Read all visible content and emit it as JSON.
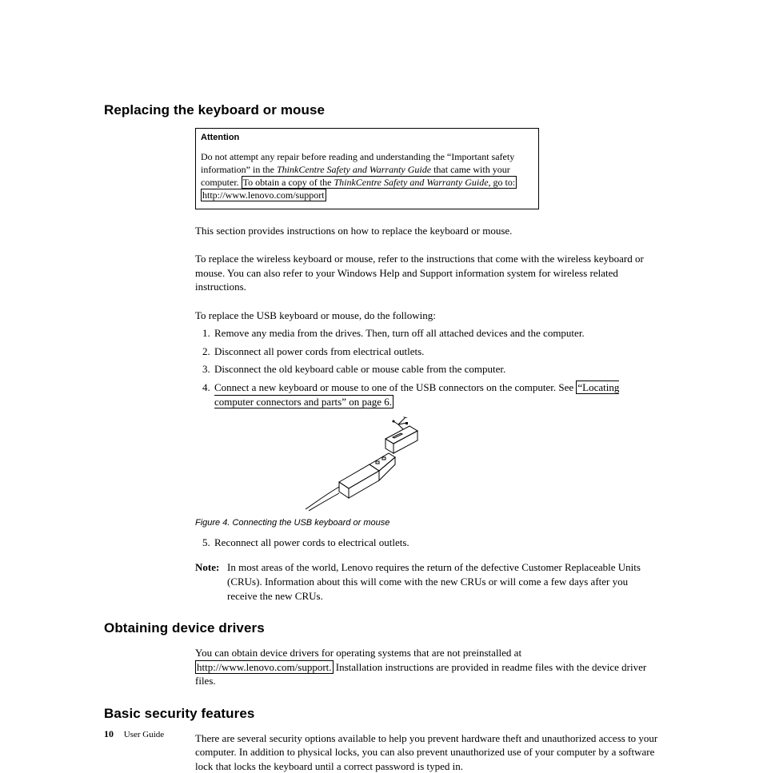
{
  "section1": {
    "title": "Replacing the keyboard or mouse",
    "attention": {
      "title": "Attention",
      "line1_a": "Do not attempt any repair before reading and understanding the “Important safety information” in the ",
      "line1_b_italic": "ThinkCentre Safety and Warranty Guide",
      "line1_c": " that came with your computer. ",
      "line2_a": "To obtain a copy of the ",
      "line2_b_italic": "ThinkCentre Safety and Warranty Guide",
      "line2_c": ", go to: ",
      "link": "http://www.lenovo.com/support"
    },
    "p1": "This section provides instructions on how to replace the keyboard or mouse.",
    "p2": "To replace the wireless keyboard or mouse, refer to the instructions that come with the wireless keyboard or mouse. You can also refer to your Windows Help and Support information system for wireless related instructions.",
    "p3": "To replace the USB keyboard or mouse, do the following:",
    "steps1": [
      "Remove any media from the drives. Then, turn off all attached devices and the computer.",
      "Disconnect all power cords from electrical outlets.",
      "Disconnect the old keyboard cable or mouse cable from the computer."
    ],
    "step4_a": "Connect a new keyboard or mouse to one of the USB connectors on the computer. See ",
    "step4_link": "“Locating computer connectors and parts” on page 6.",
    "figcaption": "Figure 4. Connecting the USB keyboard or mouse",
    "step5": "Reconnect all power cords to electrical outlets.",
    "note": {
      "label": "Note:",
      "text": "In most areas of the world, Lenovo requires the return of the defective Customer Replaceable Units (CRUs). Information about this will come with the new CRUs or will come a few days after you receive the new CRUs."
    }
  },
  "section2": {
    "title": "Obtaining device drivers",
    "p_a": "You can obtain device drivers for operating systems that are not preinstalled at ",
    "link": "http://www.lenovo.com/support.",
    "p_b": " Installation instructions are provided in readme files with the device driver files."
  },
  "section3": {
    "title": "Basic security features",
    "p": "There are several security options available to help you prevent hardware theft and unauthorized access to your computer. In addition to physical locks, you can also prevent unauthorized use of your computer by a software lock that locks the keyboard until a correct password is typed in."
  },
  "footer": {
    "page": "10",
    "label": "User Guide"
  }
}
